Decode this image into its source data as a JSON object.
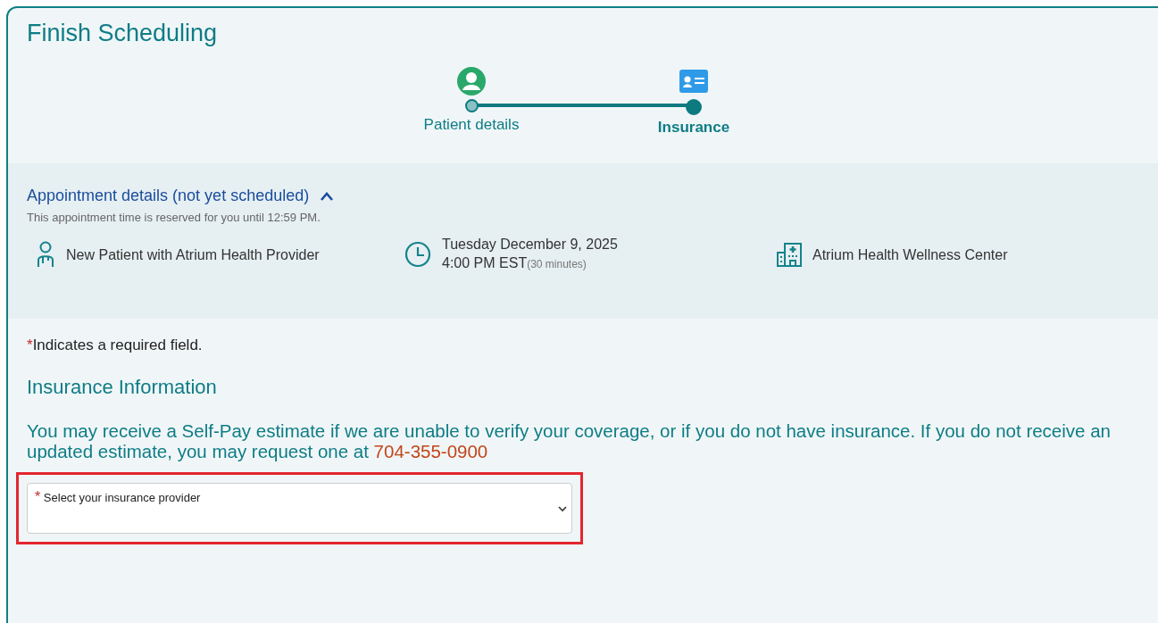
{
  "title": "Finish Scheduling",
  "steps": [
    {
      "label": "Patient details",
      "kind": "person",
      "selected": false
    },
    {
      "label": "Insurance",
      "kind": "card",
      "selected": true
    }
  ],
  "appointment": {
    "heading": "Appointment details (not yet scheduled)",
    "expanded": true,
    "note": "This appointment time is reserved for you until 12:59 PM.",
    "items": [
      {
        "kind": "provider",
        "lines": [
          "New Patient with Atrium Health Provider"
        ]
      },
      {
        "kind": "time",
        "lines": [
          "Tuesday December 9, 2025",
          "4:00 PM EST"
        ],
        "detail": "(30 minutes)"
      },
      {
        "kind": "location",
        "lines": [
          "Atrium Health Wellness Center"
        ]
      }
    ]
  },
  "required_note": {
    "mark": "*",
    "text": "Indicates a required field."
  },
  "section_title": "Insurance Information",
  "notice": {
    "text": "You may receive a Self-Pay estimate if we are unable to verify your coverage, or if you do not have insurance. If you do not receive an updated estimate, you may request one at",
    "phone": "704-355-0900"
  },
  "insurance_select": {
    "mark": "*",
    "label": "Select your insurance provider",
    "highlighted": true
  }
}
